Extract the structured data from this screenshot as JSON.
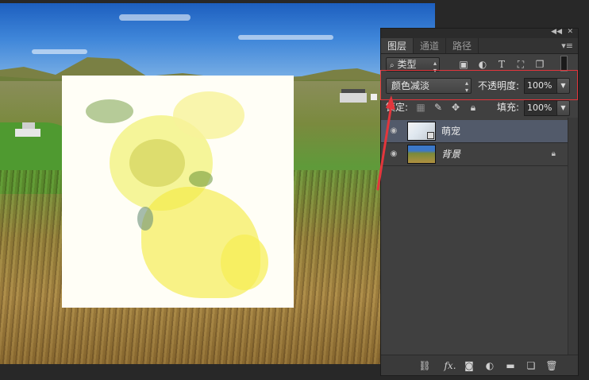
{
  "panel": {
    "tabs": [
      {
        "label": "图层",
        "active": true
      },
      {
        "label": "通道",
        "active": false
      },
      {
        "label": "路径",
        "active": false
      }
    ],
    "collapse_icon": "double-chevron-left-icon",
    "close_icon": "close-icon",
    "menu_icon": "panel-menu-icon",
    "filter": {
      "label": "类型",
      "icons": [
        "image-filter-icon",
        "adjustment-filter-icon",
        "text-filter-icon",
        "shape-filter-icon",
        "smart-object-filter-icon"
      ]
    },
    "blend_mode": "颜色减淡",
    "opacity_label": "不透明度:",
    "opacity_value": "100%",
    "lock_label": "锁定:",
    "lock_icons": [
      "lock-transparent-pixels-icon",
      "lock-image-pixels-icon",
      "lock-position-icon",
      "lock-all-icon"
    ],
    "fill_label": "填充:",
    "fill_value": "100%",
    "layers": [
      {
        "name": "萌宠",
        "selected": true,
        "visible": true,
        "locked": false
      },
      {
        "name": "背景",
        "selected": false,
        "visible": true,
        "locked": true
      }
    ],
    "footer_icons": [
      "link-layers-icon",
      "fx-icon",
      "layer-mask-icon",
      "adjustment-layer-icon",
      "new-group-icon",
      "new-layer-icon",
      "trash-icon"
    ],
    "footer_fx": "fx."
  },
  "annotation": {
    "highlight_color": "#e3363c",
    "arrow_color": "#e3363c"
  },
  "colors": {
    "panel_bg": "#404040",
    "selected_layer": "#525a6a",
    "app_bg": "#282828"
  }
}
